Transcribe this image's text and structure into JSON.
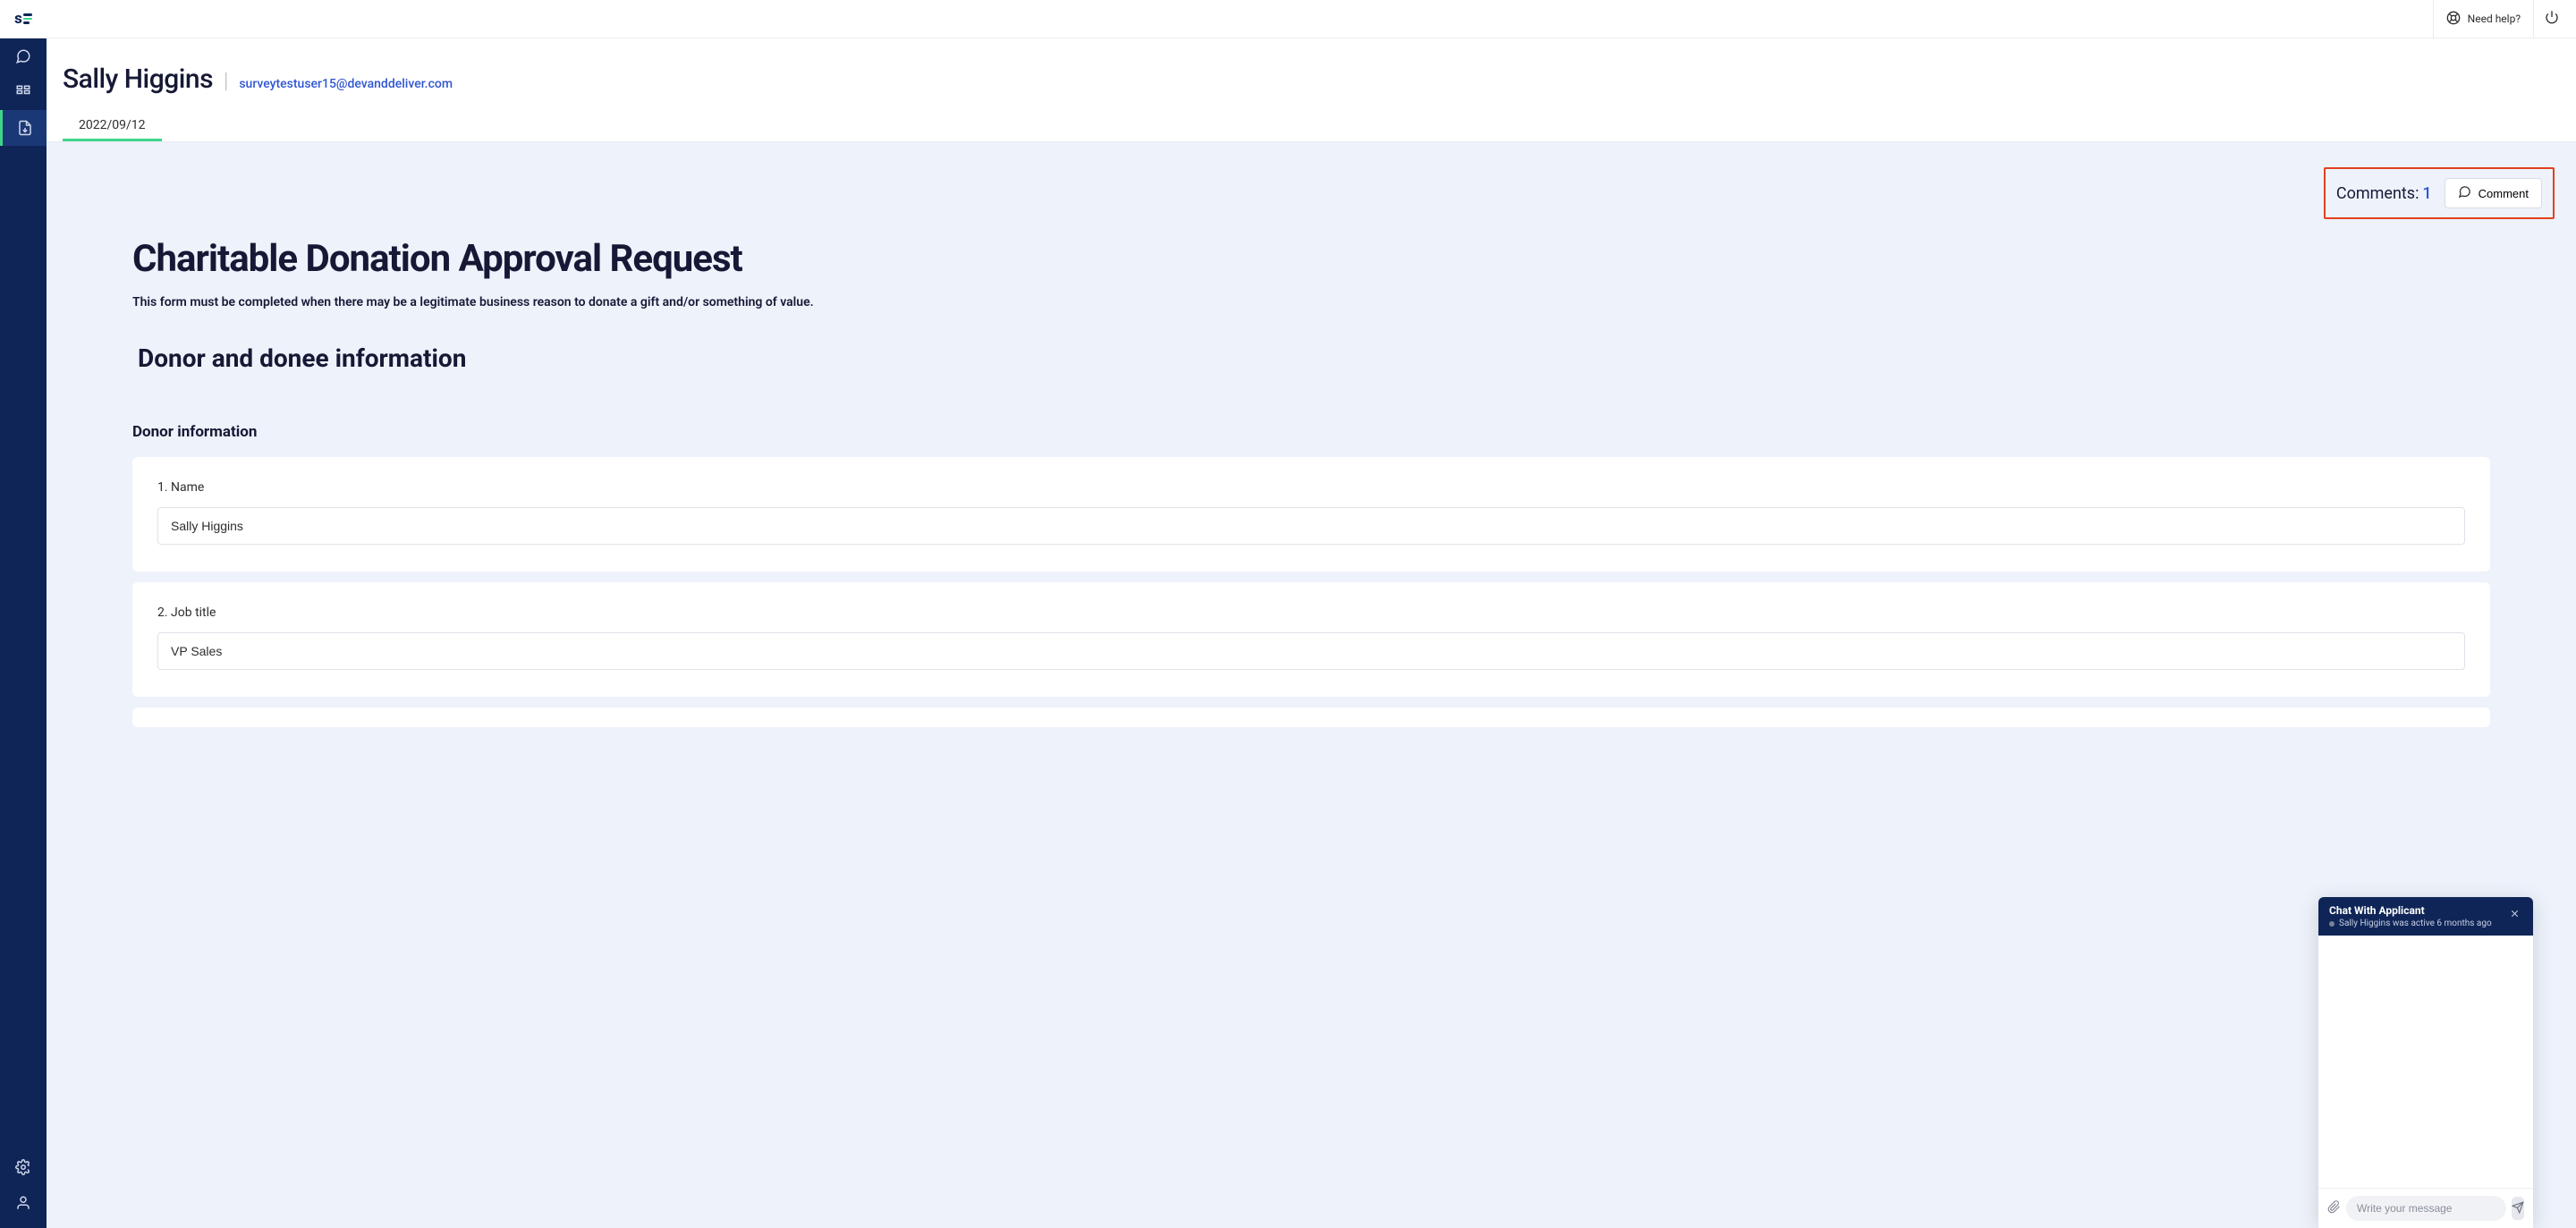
{
  "topbar": {
    "need_help_label": "Need help?"
  },
  "header": {
    "person_name": "Sally Higgins",
    "person_email": "surveytestuser15@devanddeliver.com"
  },
  "tabs": [
    {
      "label": "2022/09/12",
      "active": true
    }
  ],
  "comments": {
    "label": "Comments:",
    "count": "1",
    "button_label": "Comment"
  },
  "form": {
    "title": "Charitable Donation Approval Request",
    "description": "This form must be completed when there may be a legitimate business reason to donate a gift and/or something of value.",
    "section1_title": "Donor and donee information",
    "donor_subsection": "Donor information",
    "fields": [
      {
        "label": "1. Name",
        "value": "Sally Higgins"
      },
      {
        "label": "2. Job title",
        "value": "VP Sales"
      }
    ]
  },
  "chat": {
    "title": "Chat With Applicant",
    "status": "Sally Higgins was active 6 months ago",
    "placeholder": "Write your message"
  }
}
